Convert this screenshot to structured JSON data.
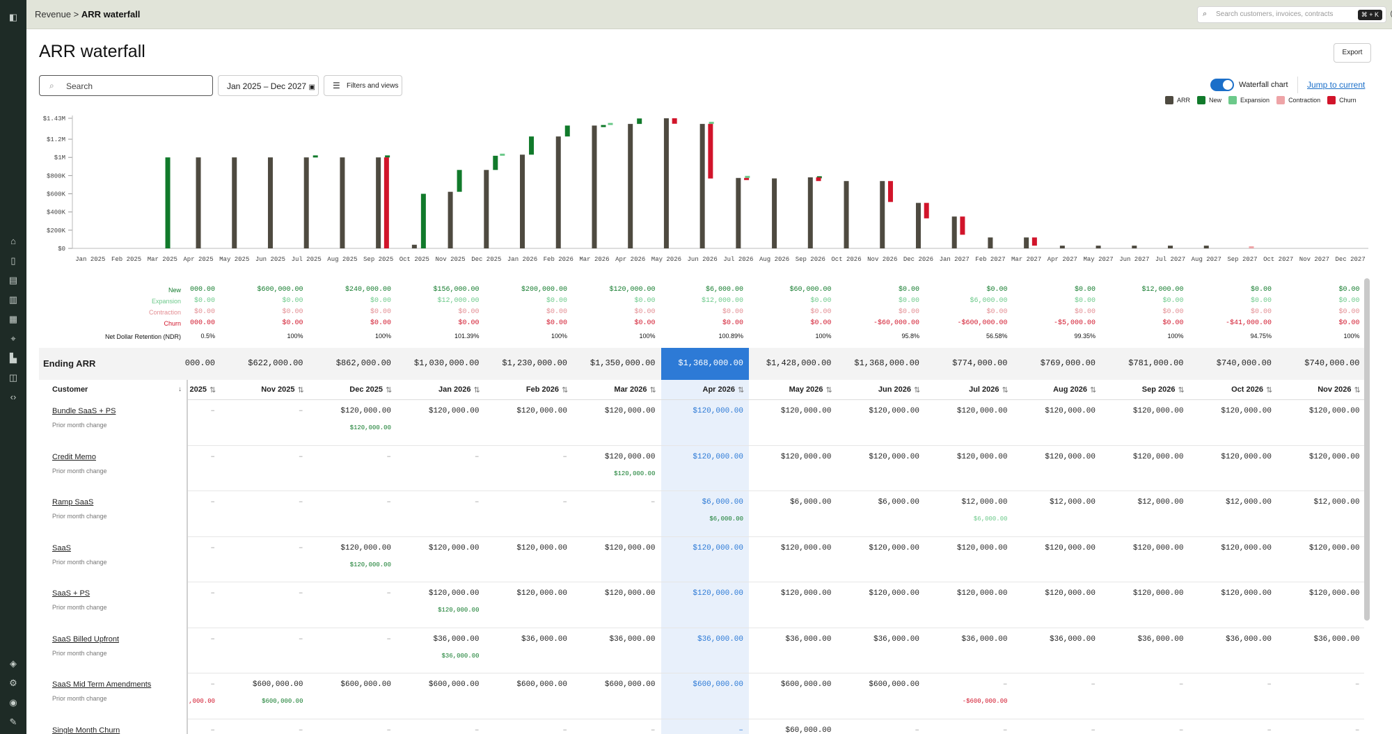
{
  "nav": {
    "breadcrumb_parent": "Revenue",
    "breadcrumb_sep": " > ",
    "breadcrumb_current": "ARR waterfall",
    "search_placeholder": "Search customers, invoices, contracts",
    "shortcut": "⌘ + K"
  },
  "page": {
    "title": "ARR waterfall",
    "export_label": "Export",
    "search_value": "Search",
    "date_range": "Jan 2025 – Dec 2027",
    "filters_label": "Filters and views",
    "toggle_label": "Waterfall chart",
    "toggle_on": true,
    "jump_label": "Jump to current"
  },
  "legend": [
    {
      "label": "ARR",
      "color": "#4e4a40"
    },
    {
      "label": "New",
      "color": "#117a2b"
    },
    {
      "label": "Expansion",
      "color": "#6cc98a"
    },
    {
      "label": "Contraction",
      "color": "#eea4a7"
    },
    {
      "label": "Churn",
      "color": "#d1142a"
    }
  ],
  "chart_data": {
    "type": "bar",
    "title": "",
    "xlabel": "",
    "ylabel": "",
    "y_ticks": [
      "$0",
      "$200K",
      "$400K",
      "$600K",
      "$800K",
      "$1M",
      "$1.2M",
      "$1.43M"
    ],
    "ylim": [
      0,
      1430000
    ],
    "categories": [
      "Jan 2025",
      "Feb 2025",
      "Mar 2025",
      "Apr 2025",
      "May 2025",
      "Jun 2025",
      "Jul 2025",
      "Aug 2025",
      "Sep 2025",
      "Oct 2025",
      "Nov 2025",
      "Dec 2025",
      "Jan 2026",
      "Feb 2026",
      "Mar 2026",
      "Apr 2026",
      "May 2026",
      "Jun 2026",
      "Jul 2026",
      "Aug 2026",
      "Sep 2026",
      "Oct 2026",
      "Nov 2026",
      "Dec 2026",
      "Jan 2027",
      "Feb 2027",
      "Mar 2027",
      "Apr 2027",
      "May 2027",
      "Jun 2027",
      "Jul 2027",
      "Aug 2027",
      "Sep 2027",
      "Oct 2027",
      "Nov 2027",
      "Dec 2027"
    ],
    "series": [
      {
        "name": "ARR",
        "values": [
          0,
          0,
          0,
          1000000,
          1000000,
          1000000,
          1000000,
          1000000,
          1000000,
          40000,
          622000,
          862000,
          1030000,
          1230000,
          1350000,
          1368000,
          1430000,
          1368000,
          774000,
          769000,
          781000,
          740000,
          740000,
          500000,
          350000,
          120000,
          120000,
          30000,
          30000,
          30000,
          30000,
          30000,
          0,
          0,
          0,
          0
        ]
      },
      {
        "name": "New",
        "values": [
          0,
          0,
          0,
          1000000,
          0,
          0,
          22000,
          0,
          22000,
          600000,
          240000,
          156000,
          200000,
          120000,
          6000,
          60000,
          0,
          0,
          0,
          0,
          12000,
          0,
          0,
          0,
          0,
          0,
          0,
          0,
          0,
          0,
          0,
          0,
          0,
          0,
          0,
          0
        ]
      },
      {
        "name": "Expansion",
        "values": [
          0,
          0,
          0,
          0,
          0,
          0,
          0,
          0,
          0,
          0,
          0,
          12000,
          0,
          0,
          12000,
          0,
          0,
          12000,
          6000,
          0,
          0,
          0,
          0,
          0,
          0,
          0,
          0,
          0,
          0,
          0,
          0,
          0,
          0,
          0,
          0,
          0
        ]
      },
      {
        "name": "Contraction",
        "values": [
          0,
          0,
          0,
          0,
          0,
          0,
          0,
          0,
          0,
          0,
          0,
          0,
          0,
          0,
          0,
          0,
          0,
          0,
          0,
          0,
          0,
          0,
          0,
          0,
          0,
          0,
          0,
          0,
          0,
          0,
          0,
          0,
          20000,
          0,
          0,
          0
        ]
      },
      {
        "name": "Churn",
        "values": [
          0,
          0,
          0,
          0,
          0,
          0,
          0,
          0,
          0,
          1000000,
          0,
          0,
          0,
          0,
          0,
          0,
          0,
          60000,
          600000,
          5000,
          0,
          41000,
          0,
          230000,
          170000,
          200000,
          0,
          90000,
          0,
          0,
          0,
          0,
          0,
          0,
          0,
          0
        ]
      }
    ]
  },
  "metrics": {
    "labels": [
      "New",
      "Expansion",
      "Contraction",
      "Churn",
      "Net Dollar Retention (NDR)"
    ],
    "colors": [
      "#117a2b",
      "#6cc98a",
      "#e38d92",
      "#d1142a",
      "#111"
    ],
    "columns": [
      {
        "new": "000.00",
        "exp": "$0.00",
        "con": "$0.00",
        "churn": "000.00",
        "ndr": "0.5%"
      },
      {
        "new": "$600,000.00",
        "exp": "$0.00",
        "con": "$0.00",
        "churn": "$0.00",
        "ndr": "100%"
      },
      {
        "new": "$240,000.00",
        "exp": "$0.00",
        "con": "$0.00",
        "churn": "$0.00",
        "ndr": "100%"
      },
      {
        "new": "$156,000.00",
        "exp": "$12,000.00",
        "con": "$0.00",
        "churn": "$0.00",
        "ndr": "101.39%"
      },
      {
        "new": "$200,000.00",
        "exp": "$0.00",
        "con": "$0.00",
        "churn": "$0.00",
        "ndr": "100%"
      },
      {
        "new": "$120,000.00",
        "exp": "$0.00",
        "con": "$0.00",
        "churn": "$0.00",
        "ndr": "100%"
      },
      {
        "new": "$6,000.00",
        "exp": "$12,000.00",
        "con": "$0.00",
        "churn": "$0.00",
        "ndr": "100.89%"
      },
      {
        "new": "$60,000.00",
        "exp": "$0.00",
        "con": "$0.00",
        "churn": "$0.00",
        "ndr": "100%"
      },
      {
        "new": "$0.00",
        "exp": "$0.00",
        "con": "$0.00",
        "churn": "-$60,000.00",
        "ndr": "95.8%"
      },
      {
        "new": "$0.00",
        "exp": "$6,000.00",
        "con": "$0.00",
        "churn": "-$600,000.00",
        "ndr": "56.58%"
      },
      {
        "new": "$0.00",
        "exp": "$0.00",
        "con": "$0.00",
        "churn": "-$5,000.00",
        "ndr": "99.35%"
      },
      {
        "new": "$12,000.00",
        "exp": "$0.00",
        "con": "$0.00",
        "churn": "$0.00",
        "ndr": "100%"
      },
      {
        "new": "$0.00",
        "exp": "$0.00",
        "con": "$0.00",
        "churn": "-$41,000.00",
        "ndr": "94.75%"
      },
      {
        "new": "$0.00",
        "exp": "$0.00",
        "con": "$0.00",
        "churn": "$0.00",
        "ndr": "100%"
      }
    ]
  },
  "ending": {
    "label": "Ending ARR",
    "values": [
      "000.00",
      "$622,000.00",
      "$862,000.00",
      "$1,030,000.00",
      "$1,230,000.00",
      "$1,350,000.00",
      "$1,368,000.00",
      "$1,428,000.00",
      "$1,368,000.00",
      "$774,000.00",
      "$769,000.00",
      "$781,000.00",
      "$740,000.00",
      "$740,000.00"
    ]
  },
  "table": {
    "customer_header": "Customer",
    "prior_label": "Prior month change",
    "months": [
      " 2025",
      "Nov 2025",
      "Dec 2025",
      "Jan 2026",
      "Feb 2026",
      "Mar 2026",
      "Apr 2026",
      "May 2026",
      "Jun 2026",
      "Jul 2026",
      "Aug 2026",
      "Sep 2026",
      "Oct 2026",
      "Nov 2026"
    ],
    "rows": [
      {
        "name": "Bundle SaaS + PS",
        "values": [
          "–",
          "–",
          "$120,000.00",
          "$120,000.00",
          "$120,000.00",
          "$120,000.00",
          "$120,000.00",
          "$120,000.00",
          "$120,000.00",
          "$120,000.00",
          "$120,000.00",
          "$120,000.00",
          "$120,000.00",
          "$120,000.00"
        ],
        "changes": [
          "",
          "",
          "$120,000.00",
          "",
          "",
          "",
          "",
          "",
          "",
          "",
          "",
          "",
          "",
          ""
        ]
      },
      {
        "name": "Credit Memo",
        "values": [
          "–",
          "–",
          "–",
          "–",
          "–",
          "$120,000.00",
          "$120,000.00",
          "$120,000.00",
          "$120,000.00",
          "$120,000.00",
          "$120,000.00",
          "$120,000.00",
          "$120,000.00",
          "$120,000.00"
        ],
        "changes": [
          "",
          "",
          "",
          "",
          "",
          "$120,000.00",
          "",
          "",
          "",
          "",
          "",
          "",
          "",
          ""
        ]
      },
      {
        "name": "Ramp SaaS",
        "values": [
          "–",
          "–",
          "–",
          "–",
          "–",
          "–",
          "$6,000.00",
          "$6,000.00",
          "$6,000.00",
          "$12,000.00",
          "$12,000.00",
          "$12,000.00",
          "$12,000.00",
          "$12,000.00"
        ],
        "changes": [
          "",
          "",
          "",
          "",
          "",
          "",
          "$6,000.00",
          "",
          "",
          "$6,000.00",
          "",
          "",
          "",
          ""
        ]
      },
      {
        "name": "SaaS",
        "values": [
          "–",
          "–",
          "$120,000.00",
          "$120,000.00",
          "$120,000.00",
          "$120,000.00",
          "$120,000.00",
          "$120,000.00",
          "$120,000.00",
          "$120,000.00",
          "$120,000.00",
          "$120,000.00",
          "$120,000.00",
          "$120,000.00"
        ],
        "changes": [
          "",
          "",
          "$120,000.00",
          "",
          "",
          "",
          "",
          "",
          "",
          "",
          "",
          "",
          "",
          ""
        ]
      },
      {
        "name": "SaaS + PS",
        "values": [
          "–",
          "–",
          "–",
          "$120,000.00",
          "$120,000.00",
          "$120,000.00",
          "$120,000.00",
          "$120,000.00",
          "$120,000.00",
          "$120,000.00",
          "$120,000.00",
          "$120,000.00",
          "$120,000.00",
          "$120,000.00"
        ],
        "changes": [
          "",
          "",
          "",
          "$120,000.00",
          "",
          "",
          "",
          "",
          "",
          "",
          "",
          "",
          "",
          ""
        ]
      },
      {
        "name": "SaaS Billed Upfront",
        "values": [
          "–",
          "–",
          "–",
          "$36,000.00",
          "$36,000.00",
          "$36,000.00",
          "$36,000.00",
          "$36,000.00",
          "$36,000.00",
          "$36,000.00",
          "$36,000.00",
          "$36,000.00",
          "$36,000.00",
          "$36,000.00"
        ],
        "changes": [
          "",
          "",
          "",
          "$36,000.00",
          "",
          "",
          "",
          "",
          "",
          "",
          "",
          "",
          "",
          ""
        ]
      },
      {
        "name": "SaaS Mid Term Amendments",
        "values": [
          "–",
          "$600,000.00",
          "$600,000.00",
          "$600,000.00",
          "$600,000.00",
          "$600,000.00",
          "$600,000.00",
          "$600,000.00",
          "$600,000.00",
          "–",
          "–",
          "–",
          "–",
          "–"
        ],
        "changes": [
          ",000.00",
          "$600,000.00",
          "",
          "",
          "",
          "",
          "",
          "",
          "",
          "-$600,000.00",
          "",
          "",
          "",
          ""
        ]
      },
      {
        "name": "Single Month Churn",
        "values": [
          "–",
          "–",
          "–",
          "–",
          "–",
          "–",
          "–",
          "$60,000.00",
          "–",
          "–",
          "–",
          "–",
          "–",
          "–"
        ],
        "changes": [
          "",
          "",
          "",
          "",
          "",
          "",
          "",
          "",
          "",
          "",
          "",
          "",
          "",
          ""
        ]
      }
    ]
  }
}
